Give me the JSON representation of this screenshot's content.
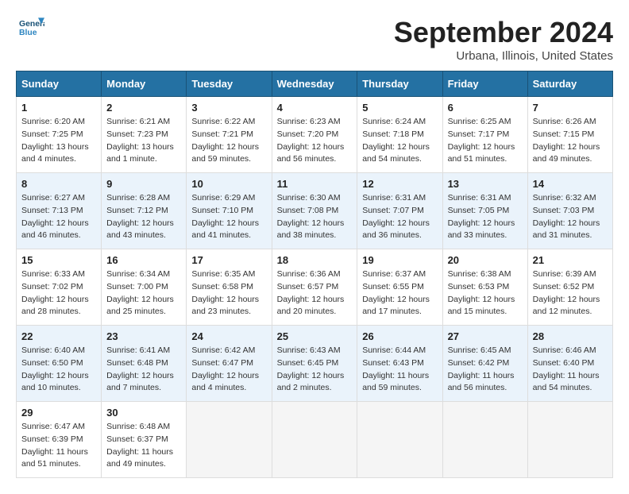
{
  "logo": {
    "general": "General",
    "blue": "Blue"
  },
  "title": "September 2024",
  "subtitle": "Urbana, Illinois, United States",
  "weekdays": [
    "Sunday",
    "Monday",
    "Tuesday",
    "Wednesday",
    "Thursday",
    "Friday",
    "Saturday"
  ],
  "weeks": [
    [
      {
        "day": 1,
        "sunrise": "6:20 AM",
        "sunset": "7:25 PM",
        "daylight": "13 hours and 4 minutes."
      },
      {
        "day": 2,
        "sunrise": "6:21 AM",
        "sunset": "7:23 PM",
        "daylight": "13 hours and 1 minute."
      },
      {
        "day": 3,
        "sunrise": "6:22 AM",
        "sunset": "7:21 PM",
        "daylight": "12 hours and 59 minutes."
      },
      {
        "day": 4,
        "sunrise": "6:23 AM",
        "sunset": "7:20 PM",
        "daylight": "12 hours and 56 minutes."
      },
      {
        "day": 5,
        "sunrise": "6:24 AM",
        "sunset": "7:18 PM",
        "daylight": "12 hours and 54 minutes."
      },
      {
        "day": 6,
        "sunrise": "6:25 AM",
        "sunset": "7:17 PM",
        "daylight": "12 hours and 51 minutes."
      },
      {
        "day": 7,
        "sunrise": "6:26 AM",
        "sunset": "7:15 PM",
        "daylight": "12 hours and 49 minutes."
      }
    ],
    [
      {
        "day": 8,
        "sunrise": "6:27 AM",
        "sunset": "7:13 PM",
        "daylight": "12 hours and 46 minutes."
      },
      {
        "day": 9,
        "sunrise": "6:28 AM",
        "sunset": "7:12 PM",
        "daylight": "12 hours and 43 minutes."
      },
      {
        "day": 10,
        "sunrise": "6:29 AM",
        "sunset": "7:10 PM",
        "daylight": "12 hours and 41 minutes."
      },
      {
        "day": 11,
        "sunrise": "6:30 AM",
        "sunset": "7:08 PM",
        "daylight": "12 hours and 38 minutes."
      },
      {
        "day": 12,
        "sunrise": "6:31 AM",
        "sunset": "7:07 PM",
        "daylight": "12 hours and 36 minutes."
      },
      {
        "day": 13,
        "sunrise": "6:31 AM",
        "sunset": "7:05 PM",
        "daylight": "12 hours and 33 minutes."
      },
      {
        "day": 14,
        "sunrise": "6:32 AM",
        "sunset": "7:03 PM",
        "daylight": "12 hours and 31 minutes."
      }
    ],
    [
      {
        "day": 15,
        "sunrise": "6:33 AM",
        "sunset": "7:02 PM",
        "daylight": "12 hours and 28 minutes."
      },
      {
        "day": 16,
        "sunrise": "6:34 AM",
        "sunset": "7:00 PM",
        "daylight": "12 hours and 25 minutes."
      },
      {
        "day": 17,
        "sunrise": "6:35 AM",
        "sunset": "6:58 PM",
        "daylight": "12 hours and 23 minutes."
      },
      {
        "day": 18,
        "sunrise": "6:36 AM",
        "sunset": "6:57 PM",
        "daylight": "12 hours and 20 minutes."
      },
      {
        "day": 19,
        "sunrise": "6:37 AM",
        "sunset": "6:55 PM",
        "daylight": "12 hours and 17 minutes."
      },
      {
        "day": 20,
        "sunrise": "6:38 AM",
        "sunset": "6:53 PM",
        "daylight": "12 hours and 15 minutes."
      },
      {
        "day": 21,
        "sunrise": "6:39 AM",
        "sunset": "6:52 PM",
        "daylight": "12 hours and 12 minutes."
      }
    ],
    [
      {
        "day": 22,
        "sunrise": "6:40 AM",
        "sunset": "6:50 PM",
        "daylight": "12 hours and 10 minutes."
      },
      {
        "day": 23,
        "sunrise": "6:41 AM",
        "sunset": "6:48 PM",
        "daylight": "12 hours and 7 minutes."
      },
      {
        "day": 24,
        "sunrise": "6:42 AM",
        "sunset": "6:47 PM",
        "daylight": "12 hours and 4 minutes."
      },
      {
        "day": 25,
        "sunrise": "6:43 AM",
        "sunset": "6:45 PM",
        "daylight": "12 hours and 2 minutes."
      },
      {
        "day": 26,
        "sunrise": "6:44 AM",
        "sunset": "6:43 PM",
        "daylight": "11 hours and 59 minutes."
      },
      {
        "day": 27,
        "sunrise": "6:45 AM",
        "sunset": "6:42 PM",
        "daylight": "11 hours and 56 minutes."
      },
      {
        "day": 28,
        "sunrise": "6:46 AM",
        "sunset": "6:40 PM",
        "daylight": "11 hours and 54 minutes."
      }
    ],
    [
      {
        "day": 29,
        "sunrise": "6:47 AM",
        "sunset": "6:39 PM",
        "daylight": "11 hours and 51 minutes."
      },
      {
        "day": 30,
        "sunrise": "6:48 AM",
        "sunset": "6:37 PM",
        "daylight": "11 hours and 49 minutes."
      },
      null,
      null,
      null,
      null,
      null
    ]
  ]
}
